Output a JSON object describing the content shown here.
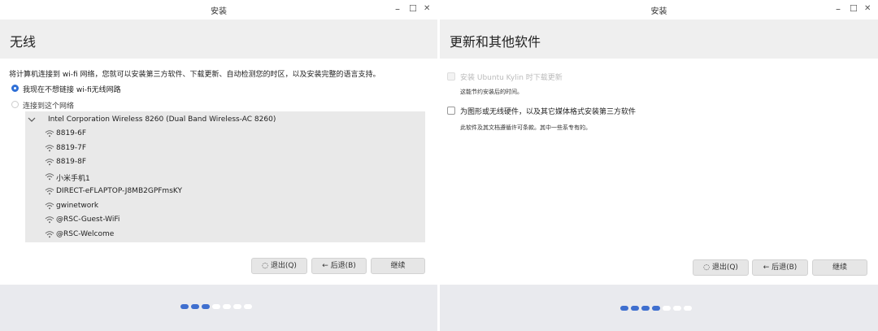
{
  "win1": {
    "title": "安装",
    "controls": {
      "minimize": "–",
      "maximize": "☐",
      "close": "✕"
    },
    "heading": "无线",
    "description": "将计算机连接到 wi-fi 网络，您就可以安装第三方软件、下载更新、自动检测您的时区，以及安装完整的语言支持。",
    "options": [
      {
        "label": "我现在不想链接 wi-fi无线网路",
        "selected": true
      },
      {
        "label": "连接到这个网络",
        "selected": false
      }
    ],
    "adapter": "Intel Corporation Wireless 8260 (Dual Band Wireless-AC 8260)",
    "networks": [
      "8819-6F",
      "8819-7F",
      "8819-8F",
      "小米手机1",
      "DIRECT-eFLAPTOP-J8MB2GPFmsKY",
      "gwinetwork",
      "@RSC-Guest-WiFi",
      "@RSC-Welcome"
    ],
    "buttons": {
      "quit": "退出(Q)",
      "back": "后退(B)",
      "continue": "继续"
    },
    "progress": {
      "total": 7,
      "done": 3
    }
  },
  "win2": {
    "title": "安装",
    "controls": {
      "minimize": "–",
      "maximize": "☐",
      "close": "✕"
    },
    "heading": "更新和其他软件",
    "options": [
      {
        "label": "安装 Ubuntu Kylin 时下载更新",
        "note": "这能节约安装后的时间。",
        "disabled": true,
        "checked": false
      },
      {
        "label": "为图形或无线硬件，以及其它媒体格式安装第三方软件",
        "note": "此软件及其文档遵循许可条款。其中一些系专有的。",
        "disabled": false,
        "checked": false
      }
    ],
    "buttons": {
      "quit": "退出(Q)",
      "back": "后退(B)",
      "continue": "继续"
    },
    "progress": {
      "total": 7,
      "done": 4
    }
  },
  "colors": {
    "accent": "#3f6fcf",
    "header_bg": "#efefef",
    "footer_bg": "#e9eaee",
    "list_bg": "#e9e9e9"
  },
  "icons": {
    "wifi": "wifi-icon",
    "chevron": "chevron-down-icon",
    "power": "power-icon",
    "back": "arrow-left-icon"
  }
}
